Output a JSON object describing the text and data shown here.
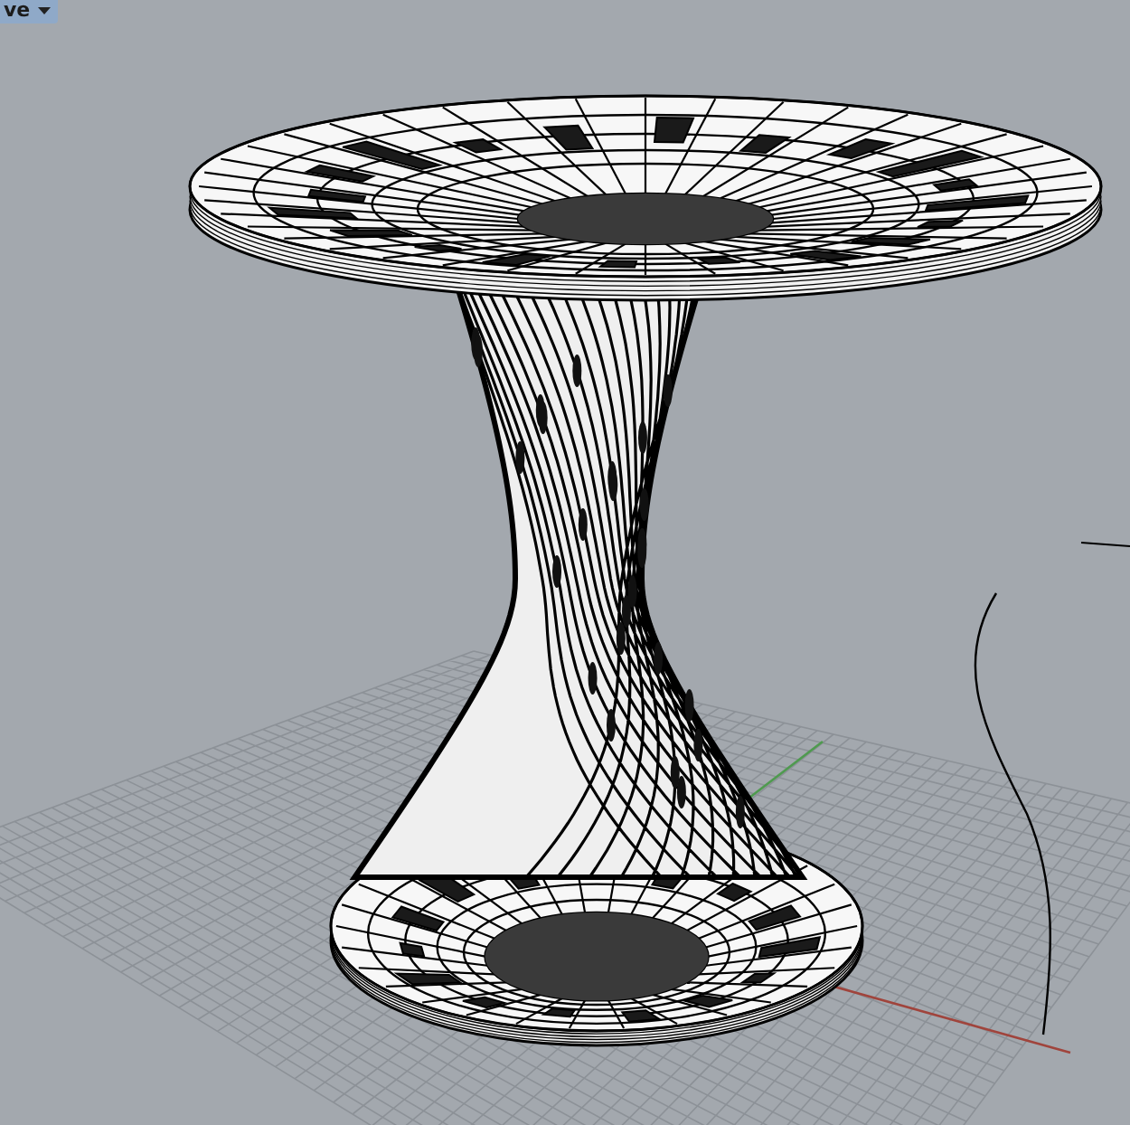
{
  "viewport": {
    "label": "ve"
  }
}
